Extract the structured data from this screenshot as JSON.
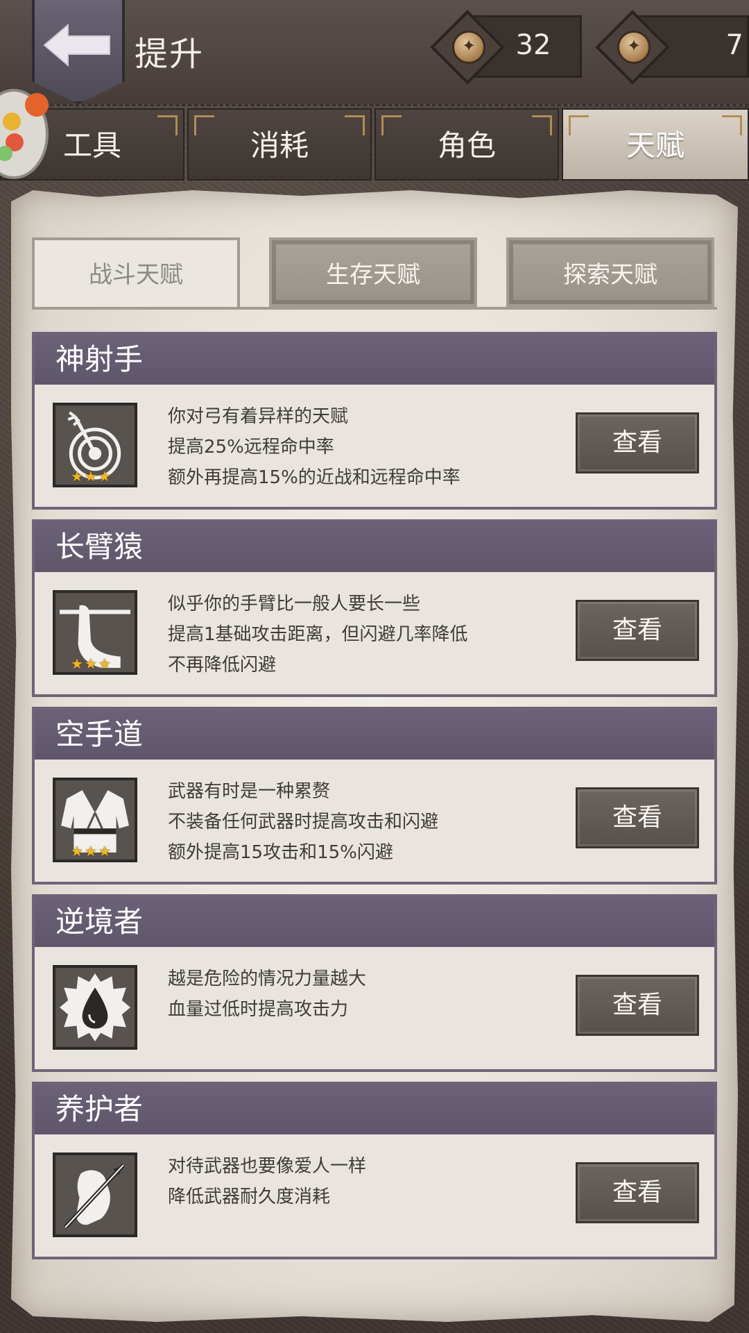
{
  "header": {
    "title": "提升",
    "currencies": [
      {
        "icon": "coin-icon",
        "value": "32"
      },
      {
        "icon": "coin-icon",
        "value": "7"
      }
    ]
  },
  "category_tabs": [
    {
      "label": "工具",
      "active": false
    },
    {
      "label": "消耗",
      "active": false
    },
    {
      "label": "角色",
      "active": false
    },
    {
      "label": "天赋",
      "active": true
    }
  ],
  "sub_tabs": [
    {
      "label": "战斗天赋",
      "active": true
    },
    {
      "label": "生存天赋",
      "active": false
    },
    {
      "label": "探索天赋",
      "active": false
    }
  ],
  "talents": [
    {
      "name": "神射手",
      "icon": "target-arrow-icon",
      "stars": "★★★",
      "lines": [
        "你对弓有着异样的天赋",
        "提高25%远程命中率",
        "额外再提高15%的近战和远程命中率"
      ],
      "button": "查看"
    },
    {
      "name": "长臂猿",
      "icon": "long-arm-icon",
      "stars": "★★★",
      "lines": [
        "似乎你的手臂比一般人要长一些",
        "提高1基础攻击距离，但闪避几率降低",
        "不再降低闪避"
      ],
      "button": "查看"
    },
    {
      "name": "空手道",
      "icon": "karate-gi-icon",
      "stars": "★★★",
      "lines": [
        "武器有时是一种累赘",
        "不装备任何武器时提高攻击和闪避",
        "额外提高15攻击和15%闪避"
      ],
      "button": "查看"
    },
    {
      "name": "逆境者",
      "icon": "blood-drop-icon",
      "stars": "",
      "lines": [
        "越是危险的情况力量越大",
        "血量过低时提高攻击力"
      ],
      "button": "查看"
    },
    {
      "name": "养护者",
      "icon": "spear-repair-icon",
      "stars": "",
      "lines": [
        "对待武器也要像爱人一样",
        "降低武器耐久度消耗"
      ],
      "button": "查看"
    }
  ]
}
